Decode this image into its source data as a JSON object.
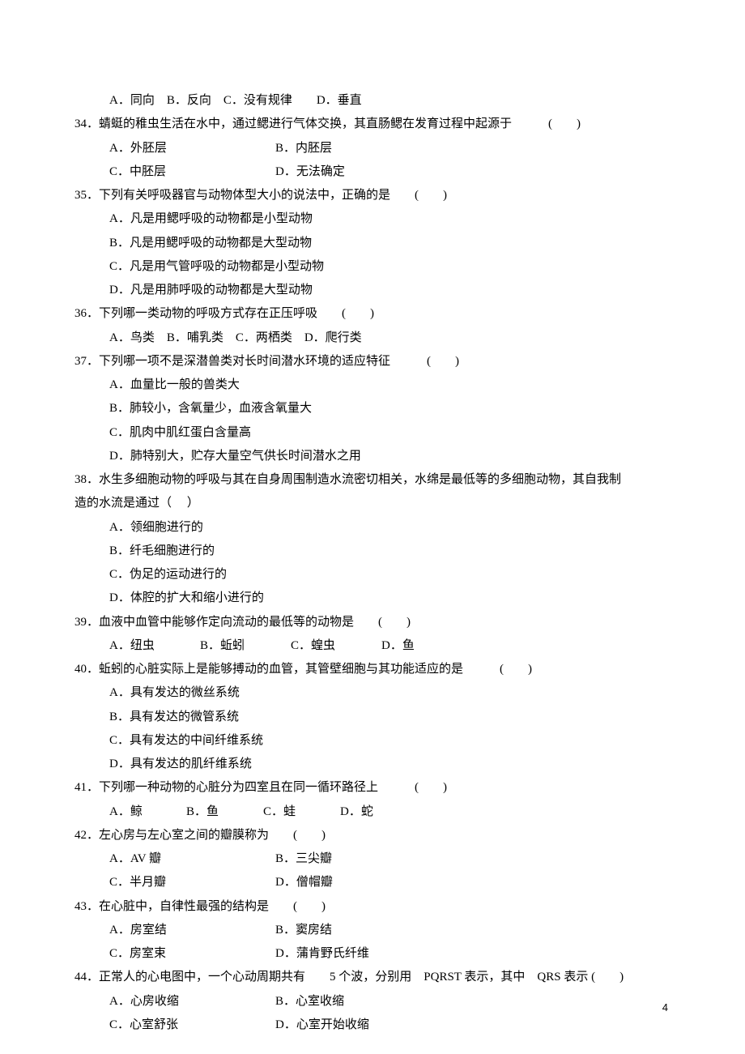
{
  "page_number": "4",
  "questions": [
    {
      "stem_inline_options": true,
      "indent_only": true,
      "options_inline": "A．同向　B．反向　C．没有规律　　D．垂直"
    },
    {
      "num": "34．",
      "stem": "蜻蜓的稚虫生活在水中，通过鳃进行气体交换，其直肠鳃在发育过程中起源于　　　(　　)",
      "options": [
        [
          {
            "t": "A．外胚层",
            "cls": "w190"
          },
          {
            "t": "B．内胚层",
            "cls": ""
          }
        ],
        [
          {
            "t": "C．中胚层",
            "cls": "w190"
          },
          {
            "t": "D．无法确定",
            "cls": ""
          }
        ]
      ]
    },
    {
      "num": "35．",
      "stem": "下列有关呼吸器官与动物体型大小的说法中，正确的是　　(　　)",
      "options": [
        [
          {
            "t": "A．凡是用鳃呼吸的动物都是小型动物",
            "cls": ""
          }
        ],
        [
          {
            "t": "B．凡是用鳃呼吸的动物都是大型动物",
            "cls": ""
          }
        ],
        [
          {
            "t": "C．凡是用气管呼吸的动物都是小型动物",
            "cls": ""
          }
        ],
        [
          {
            "t": "D．凡是用肺呼吸的动物都是大型动物",
            "cls": ""
          }
        ]
      ]
    },
    {
      "num": "36．",
      "stem": "下列哪一类动物的呼吸方式存在正压呼吸　　(　　)",
      "options": [
        [
          {
            "t": "A．鸟类　B．哺乳类　C．两栖类　D．爬行类",
            "cls": ""
          }
        ]
      ]
    },
    {
      "num": "37．",
      "stem": "下列哪一项不是深潜兽类对长时间潜水环境的适应特征　　　(　　)",
      "options": [
        [
          {
            "t": "A．血量比一般的兽类大",
            "cls": ""
          }
        ],
        [
          {
            "t": "B．肺较小，含氧量少，血液含氧量大",
            "cls": ""
          }
        ],
        [
          {
            "t": "C．肌肉中肌红蛋白含量高",
            "cls": ""
          }
        ],
        [
          {
            "t": "D．肺特别大，贮存大量空气供长时间潜水之用",
            "cls": ""
          }
        ]
      ]
    },
    {
      "num": "38．",
      "stem": "水生多细胞动物的呼吸与其在自身周围制造水流密切相关，水绵是最低等的多细胞动物，其自我制造的水流是通过（　 ）",
      "wrap": true,
      "options": [
        [
          {
            "t": "A．领细胞进行的",
            "cls": ""
          }
        ],
        [
          {
            "t": "B．纤毛细胞进行的",
            "cls": ""
          }
        ],
        [
          {
            "t": "C．伪足的运动进行的",
            "cls": ""
          }
        ],
        [
          {
            "t": "D．体腔的扩大和缩小进行的",
            "cls": ""
          }
        ]
      ]
    },
    {
      "num": "39．",
      "stem": "血液中血管中能够作定向流动的最低等的动物是　　(　　)",
      "options": [
        [
          {
            "t": "A．纽虫",
            "cls": "w100"
          },
          {
            "t": "B．蚯蚓",
            "cls": "w100"
          },
          {
            "t": "C．蝗虫",
            "cls": "w100"
          },
          {
            "t": "D．鱼",
            "cls": ""
          }
        ]
      ]
    },
    {
      "num": "40．",
      "stem": "蚯蚓的心脏实际上是能够搏动的血管，其管壁细胞与其功能适应的是　　　(　　)",
      "options": [
        [
          {
            "t": "A．具有发达的微丝系统",
            "cls": ""
          }
        ],
        [
          {
            "t": "B．具有发达的微管系统",
            "cls": ""
          }
        ],
        [
          {
            "t": "C．具有发达的中间纤维系统",
            "cls": ""
          }
        ],
        [
          {
            "t": "D．具有发达的肌纤维系统",
            "cls": ""
          }
        ]
      ]
    },
    {
      "num": "41．",
      "stem": "下列哪一种动物的心脏分为四室且在同一循环路径上　　　(　　)",
      "options": [
        [
          {
            "t": "A．鲸",
            "cls": "w85"
          },
          {
            "t": "B．鱼",
            "cls": "w85"
          },
          {
            "t": "C．蛙",
            "cls": "w85"
          },
          {
            "t": "D．蛇",
            "cls": ""
          }
        ]
      ]
    },
    {
      "num": "42．",
      "stem": "左心房与左心室之间的瓣膜称为　　(　　)",
      "options": [
        [
          {
            "t": "A．AV 瓣",
            "cls": "w190"
          },
          {
            "t": "B．三尖瓣",
            "cls": ""
          }
        ],
        [
          {
            "t": "C．半月瓣",
            "cls": "w190"
          },
          {
            "t": "D．僧帽瓣",
            "cls": ""
          }
        ]
      ]
    },
    {
      "num": "43．",
      "stem": "在心脏中，自律性最强的结构是　　(　　)",
      "options": [
        [
          {
            "t": "A．房室结",
            "cls": "w190"
          },
          {
            "t": "B．窦房结",
            "cls": ""
          }
        ],
        [
          {
            "t": "C．房室束",
            "cls": "w190"
          },
          {
            "t": "D．蒲肯野氏纤维",
            "cls": ""
          }
        ]
      ]
    },
    {
      "num": "44．",
      "stem": "正常人的心电图中，一个心动周期共有　　5 个波，分别用　PQRST 表示，其中　QRS 表示 (　　)",
      "options": [
        [
          {
            "t": "A．心房收缩",
            "cls": "w190"
          },
          {
            "t": "B．心室收缩",
            "cls": ""
          }
        ],
        [
          {
            "t": "C．心室舒张",
            "cls": "w190"
          },
          {
            "t": "D．心室开始收缩",
            "cls": ""
          }
        ]
      ]
    }
  ]
}
